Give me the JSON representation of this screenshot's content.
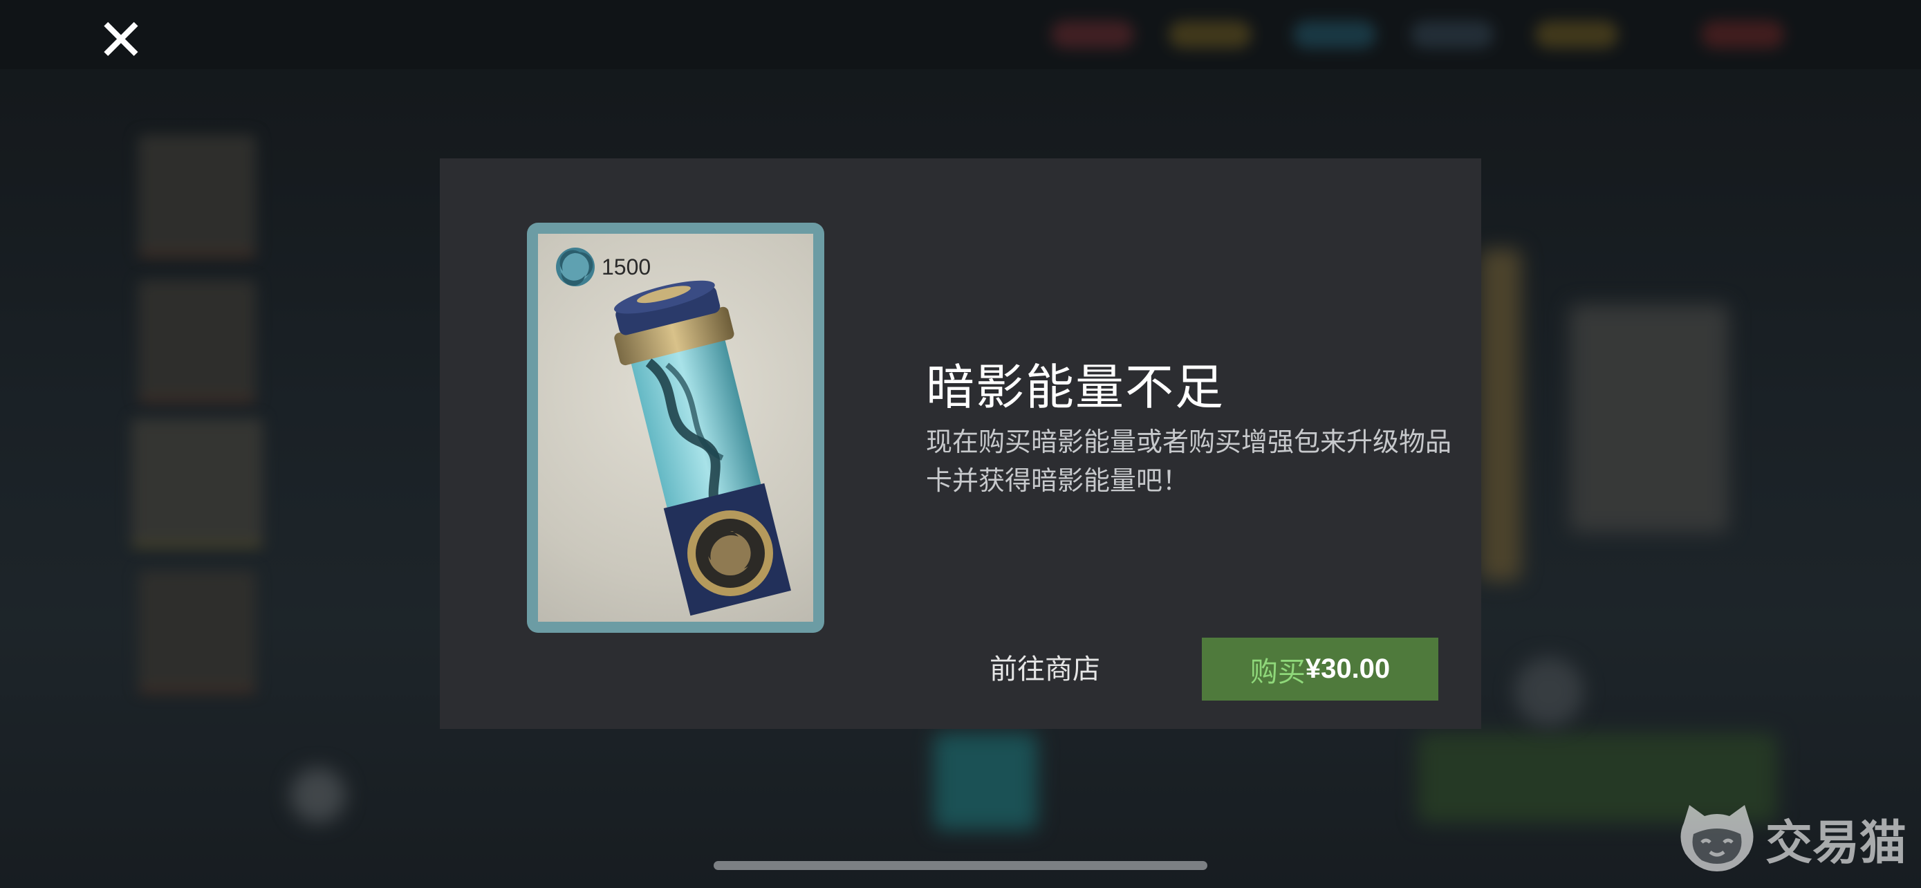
{
  "dialog": {
    "title": "暗影能量不足",
    "description": "现在购买暗影能量或者购买增强包来升级物品卡并获得暗影能量吧！",
    "item_card": {
      "cost": "1500",
      "cost_icon": "shadow-energy-icon",
      "image": "shadow-energy-vial"
    },
    "store_link": "前往商店",
    "buy_button": {
      "label": "购买",
      "price": "¥30.00"
    }
  },
  "close_icon": "close-icon",
  "watermark": {
    "text": "交易猫",
    "icon": "cat-logo-icon"
  },
  "colors": {
    "dialog_bg": "#2c2d31",
    "buy_button_bg": "#4f7a3c",
    "buy_label": "#8fd87a",
    "card_frame": "#6c9ca4"
  }
}
